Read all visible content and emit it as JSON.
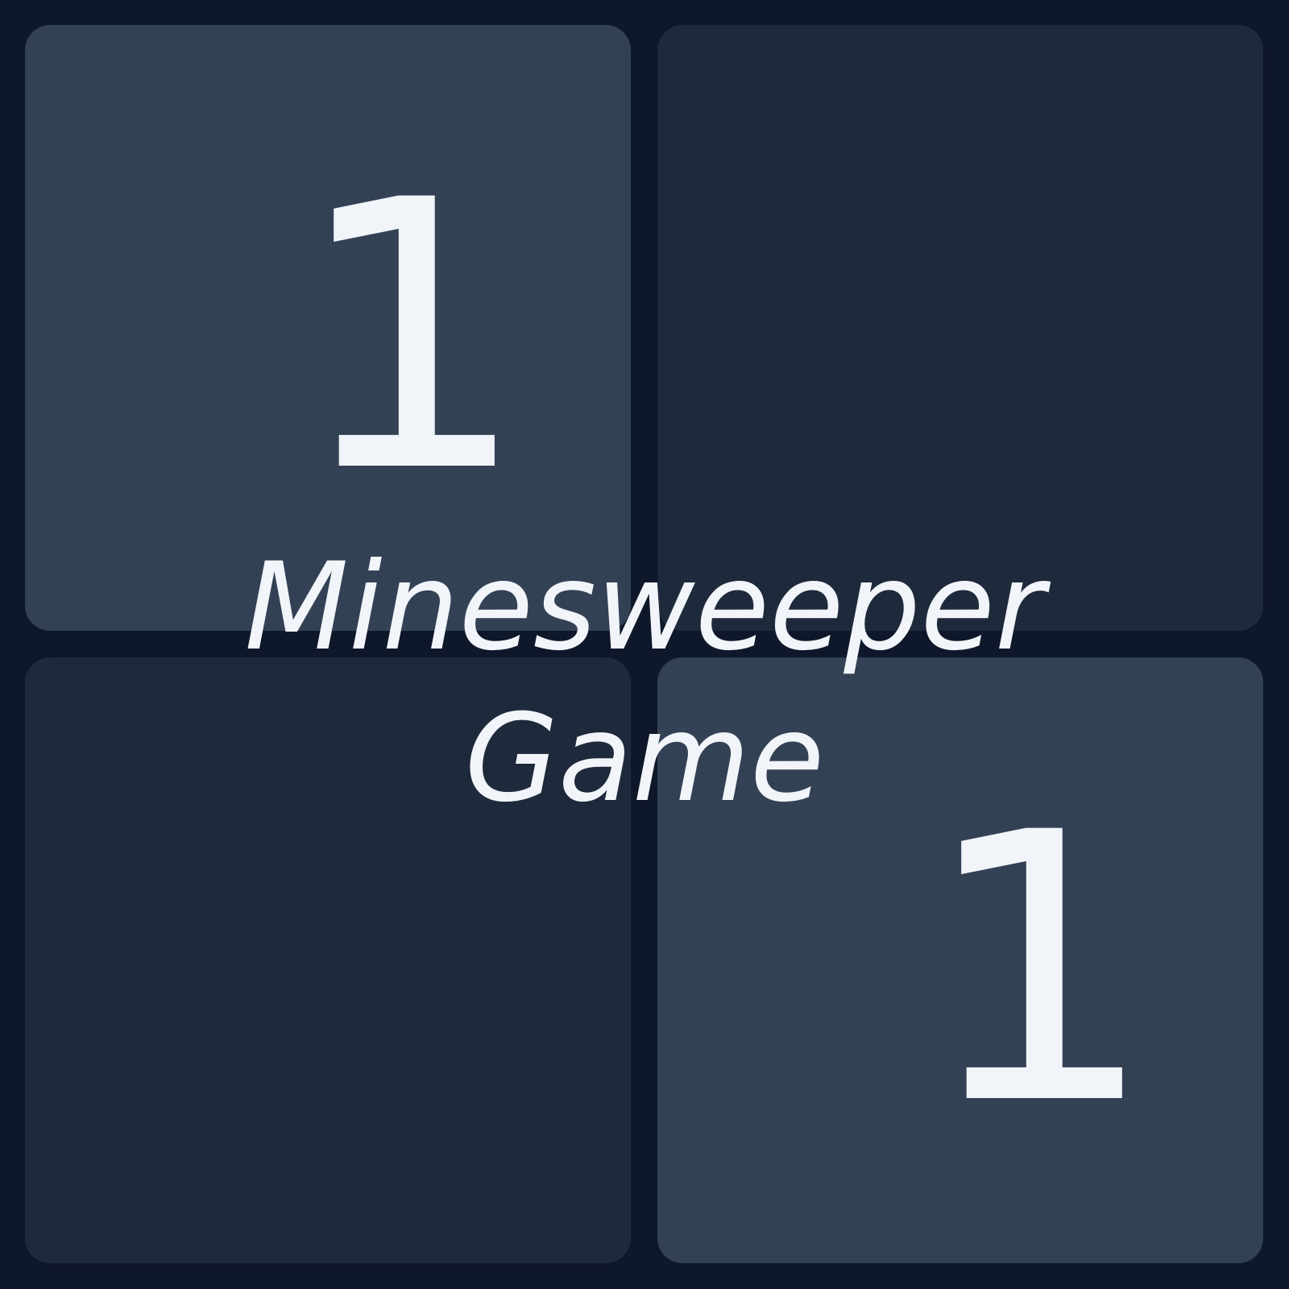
{
  "game": {
    "title_line1": "Minesweeper",
    "title_line2": "Game",
    "grid": {
      "rows": 2,
      "cols": 2,
      "cells": [
        {
          "row": 0,
          "col": 0,
          "state": "revealed",
          "value": "1"
        },
        {
          "row": 0,
          "col": 1,
          "state": "hidden",
          "value": ""
        },
        {
          "row": 1,
          "col": 0,
          "state": "hidden",
          "value": ""
        },
        {
          "row": 1,
          "col": 1,
          "state": "revealed",
          "value": "1"
        }
      ]
    }
  },
  "colors": {
    "background": "#0f172a",
    "revealed_cell": "#334155",
    "hidden_cell": "#1e293b",
    "text": "#f1f5f9"
  }
}
